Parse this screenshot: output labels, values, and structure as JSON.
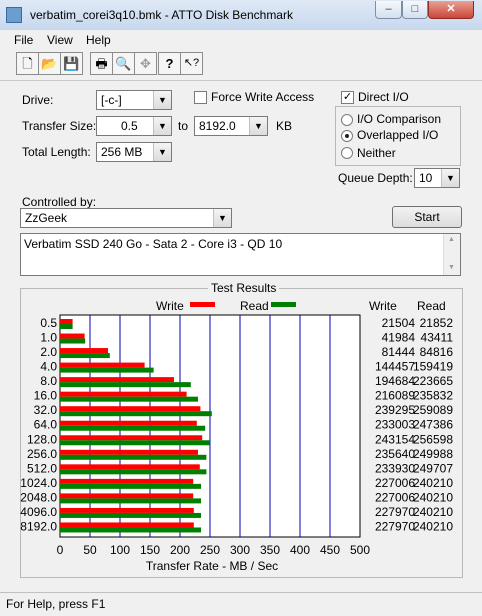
{
  "window": {
    "title": "verbatim_corei3q10.bmk - ATTO Disk Benchmark",
    "min_glyph": "–",
    "max_glyph": "□",
    "close_glyph": "✕"
  },
  "menu": [
    "File",
    "View",
    "Help"
  ],
  "toolbar": {
    "icons": [
      "new-icon",
      "open-icon",
      "save-icon",
      "print-icon",
      "print-preview-icon",
      "move-icon",
      "help-icon",
      "context-help-icon"
    ],
    "glyphs": [
      "🗋",
      "📂",
      "💾",
      "🖶",
      "🔍",
      "✥",
      "?",
      "↖?"
    ]
  },
  "form": {
    "drive_label": "Drive:",
    "drive_value": "[-c-]",
    "force_write_label": "Force Write Access",
    "force_write_checked": false,
    "direct_io_label": "Direct I/O",
    "direct_io_checked": true,
    "transfer_size_label": "Transfer Size:",
    "transfer_from": "0.5",
    "to_label": "to",
    "transfer_to": "8192.0",
    "kb_label": "KB",
    "total_length_label": "Total Length:",
    "total_length_value": "256 MB",
    "io_options": [
      "I/O Comparison",
      "Overlapped I/O",
      "Neither"
    ],
    "io_selected": "Overlapped I/O",
    "queue_depth_label": "Queue Depth:",
    "queue_depth_value": "10",
    "controlled_by_label": "Controlled by:",
    "controlled_by_value": "ZzGeek",
    "start_label": "Start",
    "description": "Verbatim SSD 240 Go - Sata 2 - Core i3 - QD 10",
    "check_glyph": "✓",
    "arrow_glyph": "▼",
    "scroll_up_glyph": "▲",
    "scroll_down_glyph": "▼"
  },
  "results": {
    "title": "Test Results",
    "write_col": "Write",
    "read_col": "Read"
  },
  "chart_data": {
    "type": "bar",
    "orientation": "horizontal",
    "xlabel": "Transfer Rate - MB / Sec",
    "xlim": [
      0,
      500
    ],
    "xticks": [
      0,
      50,
      100,
      150,
      200,
      250,
      300,
      350,
      400,
      450,
      500
    ],
    "grid": true,
    "legend_position": "top",
    "categories": [
      "0.5",
      "1.0",
      "2.0",
      "4.0",
      "8.0",
      "16.0",
      "32.0",
      "64.0",
      "128.0",
      "256.0",
      "512.0",
      "1024.0",
      "2048.0",
      "4096.0",
      "8192.0"
    ],
    "series": [
      {
        "name": "Write",
        "color": "#ff0000",
        "values": [
          21,
          41,
          80,
          141,
          190,
          211,
          234,
          228,
          237,
          230,
          233,
          222,
          222,
          223,
          223
        ]
      },
      {
        "name": "Read",
        "color": "#008000",
        "values": [
          21,
          42,
          83,
          156,
          218,
          230,
          253,
          242,
          250,
          244,
          244,
          235,
          235,
          235,
          235
        ]
      }
    ],
    "write_numbers": [
      "21504",
      "41984",
      "81444",
      "144457",
      "194684",
      "216089",
      "239295",
      "233003",
      "243154",
      "235640",
      "233930",
      "227006",
      "227006",
      "227970",
      "227970"
    ],
    "read_numbers": [
      "21852",
      "43411",
      "84816",
      "159419",
      "223665",
      "235832",
      "259089",
      "247386",
      "256598",
      "249988",
      "249707",
      "240210",
      "240210",
      "240210",
      "240210"
    ]
  },
  "status": {
    "text": "For Help, press F1"
  }
}
